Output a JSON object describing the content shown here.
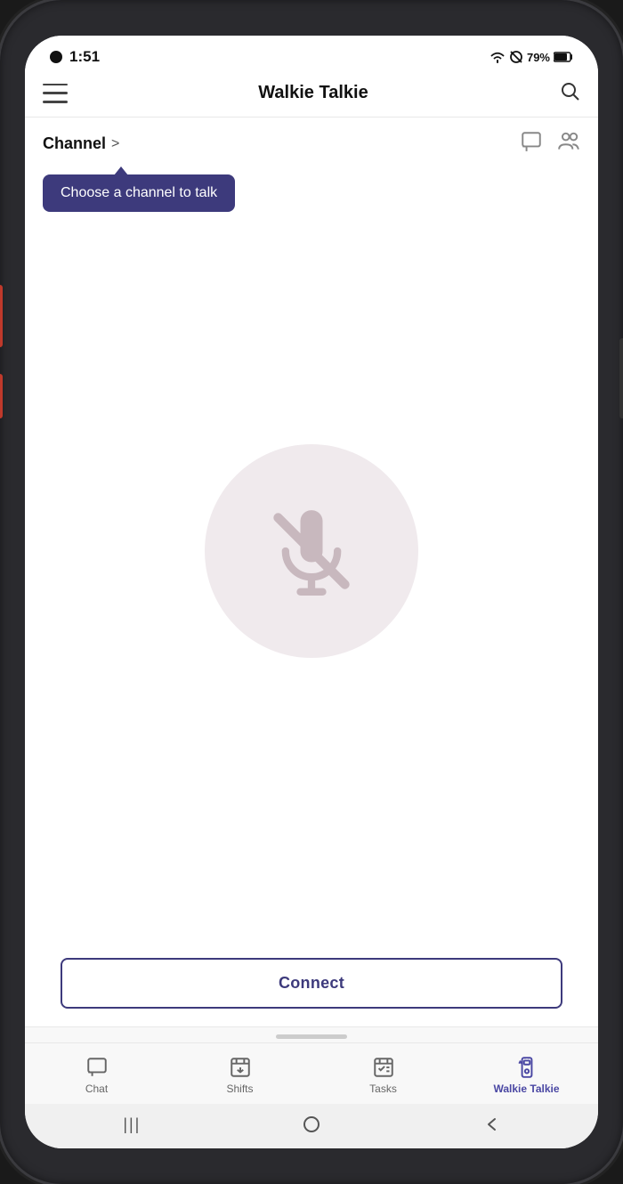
{
  "phone": {
    "status": {
      "time": "1:51",
      "wifi": "📶",
      "battery": "79%"
    }
  },
  "header": {
    "title": "Walkie Talkie",
    "hamburger_label": "menu",
    "search_label": "search"
  },
  "channel": {
    "label": "Channel",
    "chevron": ">",
    "tooltip": "Choose a channel to talk"
  },
  "connect_button": {
    "label": "Connect"
  },
  "bottom_nav": {
    "items": [
      {
        "id": "chat",
        "label": "Chat",
        "active": false
      },
      {
        "id": "shifts",
        "label": "Shifts",
        "active": false
      },
      {
        "id": "tasks",
        "label": "Tasks",
        "active": false
      },
      {
        "id": "walkie-talkie",
        "label": "Walkie Talkie",
        "active": true
      }
    ]
  },
  "system_nav": {
    "recent": "|||",
    "home": "○",
    "back": "<"
  }
}
